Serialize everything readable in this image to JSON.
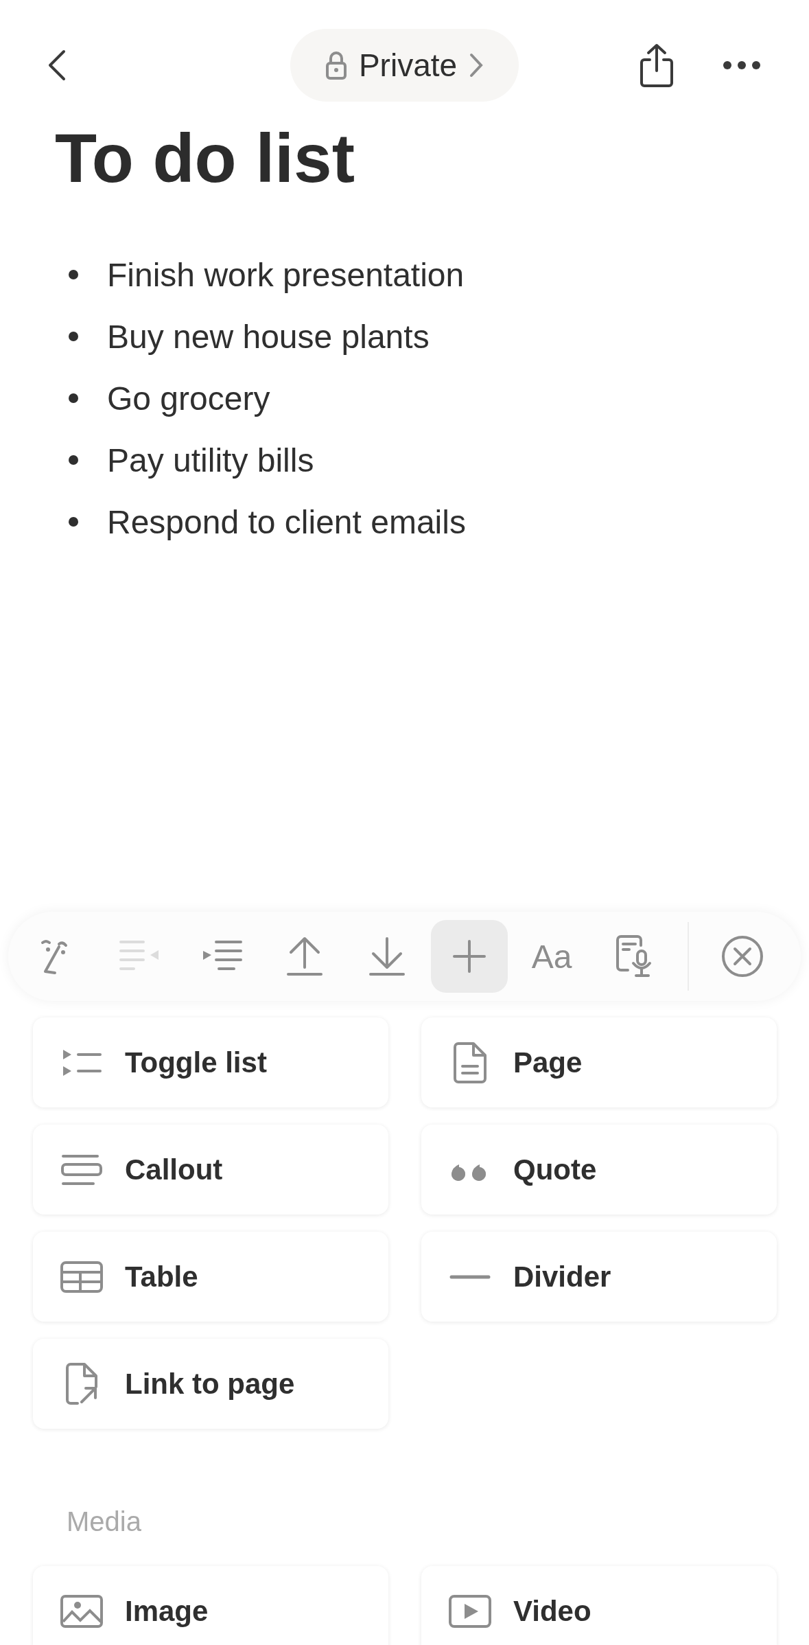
{
  "top_bar": {
    "visibility": "Private"
  },
  "title": "To do list",
  "items": [
    {
      "text": "Finish work presentation"
    },
    {
      "text": "Buy new house plants"
    },
    {
      "text": "Go grocery"
    },
    {
      "text": "Pay utility bills"
    },
    {
      "text": "Respond to client emails"
    }
  ],
  "toolbar": [
    {
      "kind": "ai",
      "disabled": false,
      "selected": false
    },
    {
      "kind": "outdent",
      "disabled": true,
      "selected": false
    },
    {
      "kind": "indent",
      "disabled": false,
      "selected": false
    },
    {
      "kind": "move-up",
      "disabled": false,
      "selected": false
    },
    {
      "kind": "move-down",
      "disabled": false,
      "selected": false
    },
    {
      "kind": "add",
      "disabled": false,
      "selected": true
    },
    {
      "kind": "text-style",
      "label": "Aa",
      "disabled": false,
      "selected": false
    },
    {
      "kind": "voice",
      "disabled": false,
      "selected": false
    },
    {
      "kind": "close",
      "disabled": false,
      "selected": false
    }
  ],
  "blocks": [
    {
      "kind": "toggle",
      "label": "Toggle list"
    },
    {
      "kind": "page",
      "label": "Page"
    },
    {
      "kind": "callout",
      "label": "Callout"
    },
    {
      "kind": "quote",
      "label": "Quote"
    },
    {
      "kind": "table",
      "label": "Table"
    },
    {
      "kind": "divider",
      "label": "Divider"
    },
    {
      "kind": "link",
      "label": "Link to page"
    }
  ],
  "media_section": {
    "heading": "Media",
    "blocks": [
      {
        "kind": "image",
        "label": "Image"
      },
      {
        "kind": "video",
        "label": "Video"
      }
    ]
  }
}
